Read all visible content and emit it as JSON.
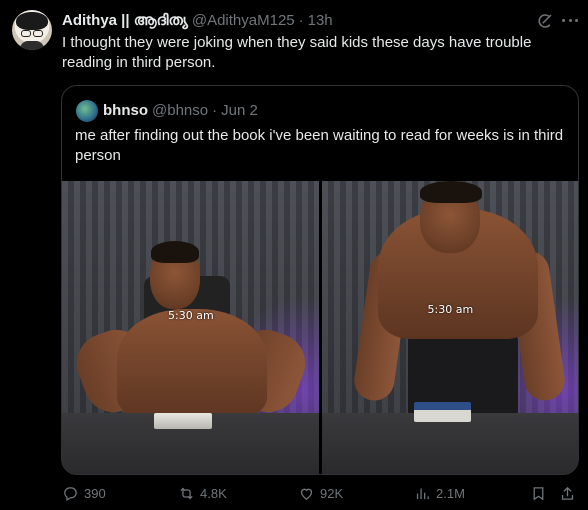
{
  "tweet": {
    "author_name": "Adithya || ആദിത്യ",
    "handle": "@AdithyaM125",
    "separator": "·",
    "time": "13h",
    "text": "I thought they were joking when they said kids these days have trouble reading in third person."
  },
  "quoted_tweet": {
    "author_name": "bhnso",
    "handle": "@bhnso",
    "separator": "·",
    "time": "Jun 2",
    "text": "me after finding out the book i've been waiting to read for weeks is in third person",
    "media": [
      {
        "timestamp_label": "5:30 am"
      },
      {
        "timestamp_label": "5:30 am"
      }
    ]
  },
  "actions": {
    "replies": "390",
    "reposts": "4.8K",
    "likes": "92K",
    "views": "2.1M"
  },
  "icons": {
    "header": [
      "grok-icon",
      "more-icon"
    ],
    "actions": [
      "reply-icon",
      "repost-icon",
      "like-icon",
      "views-icon",
      "bookmark-icon",
      "share-icon"
    ]
  },
  "colors": {
    "background": "#000000",
    "text": "#e7e9ea",
    "secondary": "#71767b",
    "border": "#2f3336"
  }
}
